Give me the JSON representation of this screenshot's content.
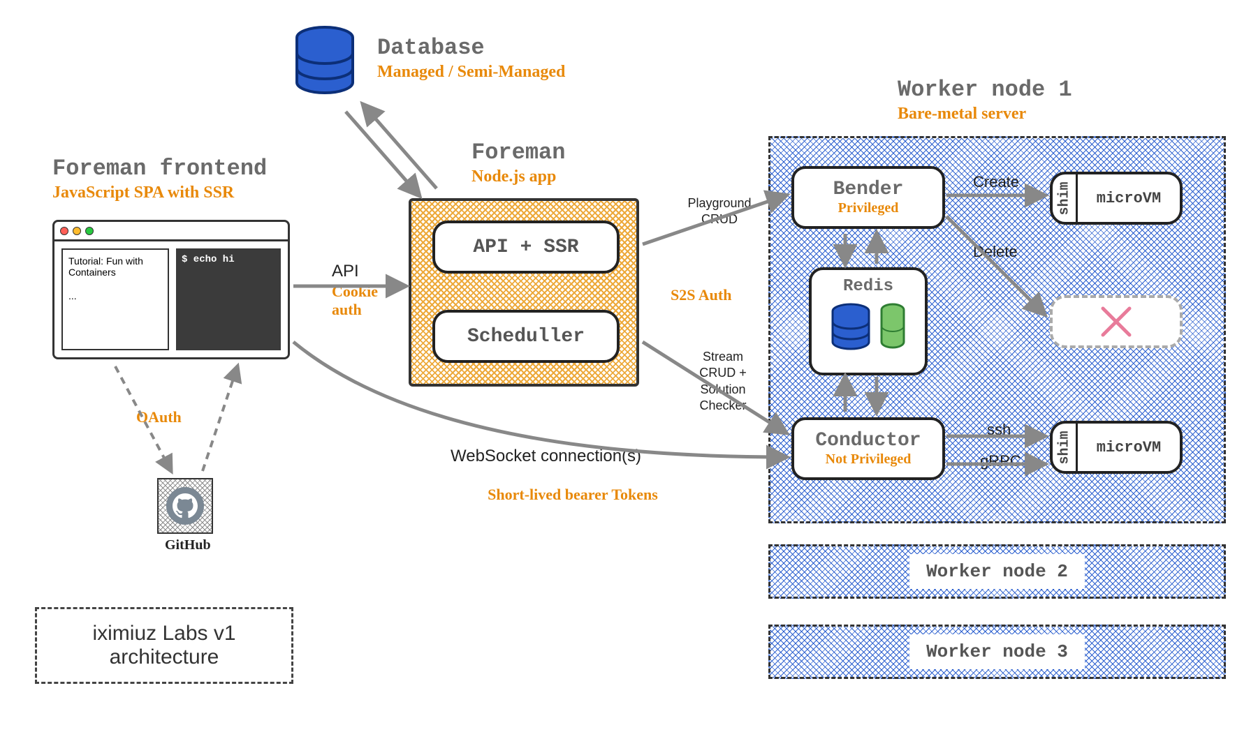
{
  "database": {
    "title": "Database",
    "subtitle": "Managed / Semi-Managed"
  },
  "frontend": {
    "title": "Foreman frontend",
    "subtitle": "JavaScript SPA with SSR",
    "tutorial_title": "Tutorial: Fun with Containers",
    "tutorial_more": "...",
    "terminal_text": "$ echo hi"
  },
  "oauth": {
    "label": "OAuth",
    "provider": "GitHub"
  },
  "api_edge": {
    "label": "API",
    "auth": "Cookie auth"
  },
  "foreman": {
    "title": "Foreman",
    "subtitle": "Node.js app",
    "box1": "API + SSR",
    "box2": "Scheduller"
  },
  "right_edges": {
    "playground": "Playground CRUD",
    "s2s": "S2S Auth",
    "stream": "Stream CRUD + Solution Checker"
  },
  "websocket": {
    "label": "WebSocket connection(s)",
    "auth": "Short-lived bearer Tokens"
  },
  "worker1": {
    "title": "Worker node 1",
    "subtitle": "Bare-metal server",
    "bender": {
      "name": "Bender",
      "role": "Privileged"
    },
    "redis": "Redis",
    "conductor": {
      "name": "Conductor",
      "role": "Not Privileged"
    },
    "create": "Create",
    "delete": "Delete",
    "ssh": "ssh",
    "grpc": "gRPC",
    "shim": "shim",
    "microvm": "microVM"
  },
  "worker2": "Worker node 2",
  "worker3": "Worker node 3",
  "caption": "iximiuz Labs v1 architecture"
}
